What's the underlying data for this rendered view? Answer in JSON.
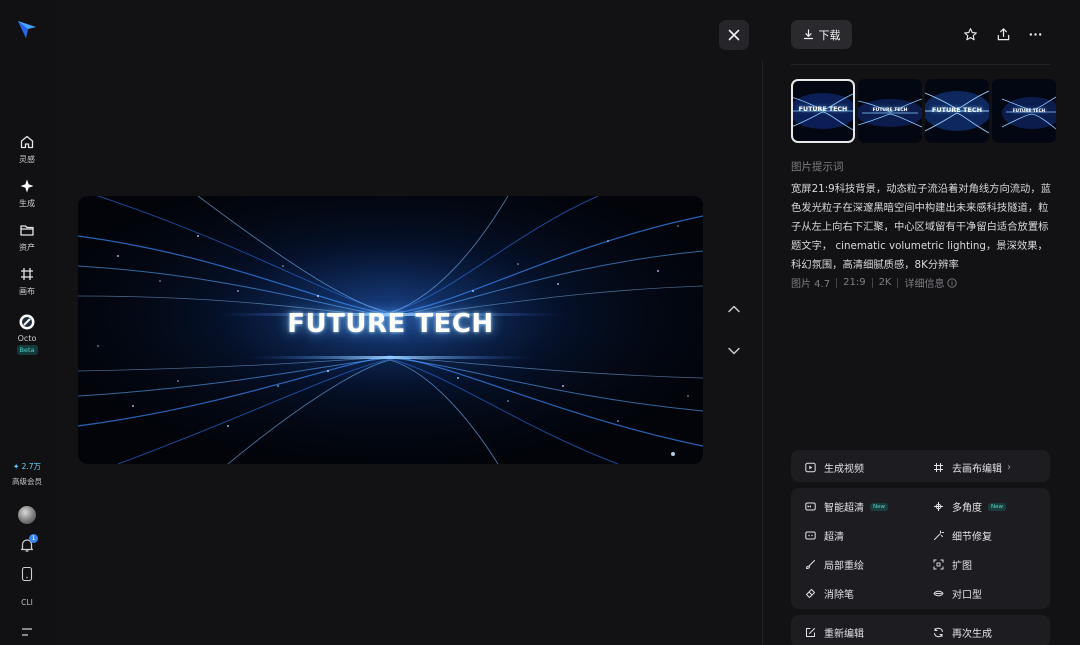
{
  "rail": {
    "items": [
      {
        "label": "灵感",
        "icon": "home-icon"
      },
      {
        "label": "生成",
        "icon": "sparkle-icon"
      },
      {
        "label": "资产",
        "icon": "folder-icon"
      },
      {
        "label": "画布",
        "icon": "canvas-icon"
      },
      {
        "label": "Octo",
        "icon": "octo-icon",
        "badge": "Beta"
      }
    ],
    "credits": "2.7万",
    "membership": "高级会员",
    "notification_count": "1",
    "cli": "CLI"
  },
  "viewer": {
    "image_text": "FUTURE TECH"
  },
  "panel": {
    "download": "下载",
    "prompt_label": "图片提示词",
    "prompt": "宽屏21:9科技背景，动态粒子流沿着对角线方向流动，蓝色发光粒子在深邃黑暗空间中构建出未来感科技隧道，粒子从左上向右下汇聚，中心区域留有干净留白适合放置标题文字， cinematic volumetric lighting，景深效果，科幻氛围，高清细腻质感，8K分辨率",
    "meta": {
      "model": "图片 4.7",
      "ratio": "21:9",
      "resolution": "2K",
      "details": "详细信息"
    },
    "thumb_text": "FUTURE TECH",
    "actions_top": [
      {
        "label": "生成视频",
        "icon": "play-icon"
      },
      {
        "label": "去画布编辑",
        "icon": "canvas-edit-icon",
        "chevron": "›"
      }
    ],
    "actions_mid": [
      {
        "label": "智能超清",
        "icon": "smart-hd-icon",
        "badge": "New"
      },
      {
        "label": "多角度",
        "icon": "multi-angle-icon",
        "badge": "New"
      },
      {
        "label": "超清",
        "icon": "hd-icon"
      },
      {
        "label": "细节修复",
        "icon": "magic-wand-icon"
      },
      {
        "label": "局部重绘",
        "icon": "brush-icon"
      },
      {
        "label": "扩图",
        "icon": "expand-icon"
      },
      {
        "label": "消除笔",
        "icon": "eraser-icon"
      },
      {
        "label": "对口型",
        "icon": "lip-sync-icon"
      }
    ],
    "actions_bottom": [
      {
        "label": "重新编辑",
        "icon": "edit-icon"
      },
      {
        "label": "再次生成",
        "icon": "regenerate-icon"
      }
    ]
  },
  "colors": {
    "background": "#121214",
    "card": "#1d1d21",
    "accent_blue": "#3b82f6",
    "badge_teal": "#58d3c4"
  }
}
